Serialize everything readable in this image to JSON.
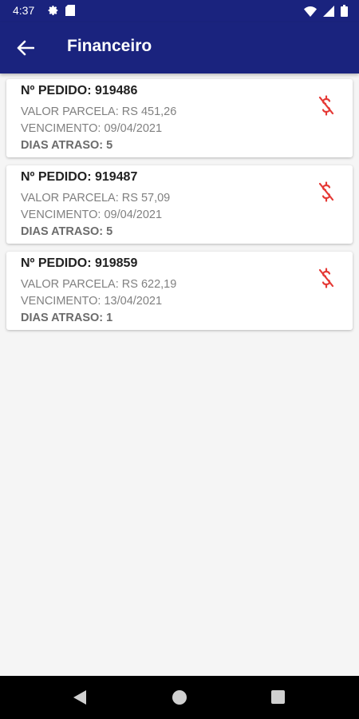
{
  "status_bar": {
    "time": "4:37",
    "left_icons": [
      "settings-icon",
      "sim-card-icon"
    ],
    "right_icons": [
      "wifi-icon",
      "cellular-signal-icon",
      "battery-icon"
    ]
  },
  "app_bar": {
    "title": "Financeiro",
    "back_icon": "arrow-back-icon",
    "background_color": "#1a237e"
  },
  "orders": [
    {
      "pedido": "Nº PEDIDO: 919486",
      "valor": "VALOR PARCELA: RS 451,26",
      "vencimento": "VENCIMENTO: 09/04/2021",
      "atraso": "DIAS ATRASO: 5",
      "icon": "money-off-icon"
    },
    {
      "pedido": "Nº PEDIDO: 919487",
      "valor": "VALOR PARCELA: RS 57,09",
      "vencimento": "VENCIMENTO: 09/04/2021",
      "atraso": "DIAS ATRASO: 5",
      "icon": "money-off-icon"
    },
    {
      "pedido": "Nº PEDIDO: 919859",
      "valor": "VALOR PARCELA: RS 622,19",
      "vencimento": "VENCIMENTO: 13/04/2021",
      "atraso": "DIAS ATRASO: 1",
      "icon": "money-off-icon"
    }
  ],
  "colors": {
    "accent_red": "#e53935",
    "card_background": "#ffffff",
    "page_background": "#f5f5f5"
  },
  "nav_bar": {
    "icons": [
      "nav-back-icon",
      "nav-home-icon",
      "nav-recents-icon"
    ]
  }
}
